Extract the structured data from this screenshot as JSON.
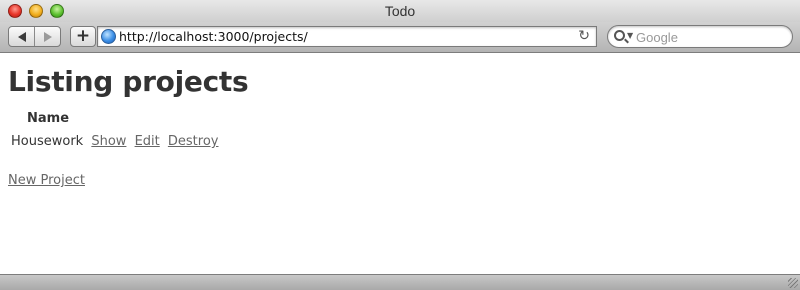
{
  "window": {
    "title": "Todo"
  },
  "toolbar": {
    "back_icon": "back-arrow-icon",
    "forward_icon": "forward-arrow-icon",
    "add_label": "+",
    "url": "http://localhost:3000/projects/",
    "search_placeholder": "Google"
  },
  "page": {
    "title": "Listing projects",
    "table": {
      "columns": [
        "Name"
      ],
      "rows": [
        {
          "name": "Housework",
          "actions": [
            "Show",
            "Edit",
            "Destroy"
          ]
        }
      ]
    },
    "new_link": "New Project"
  }
}
